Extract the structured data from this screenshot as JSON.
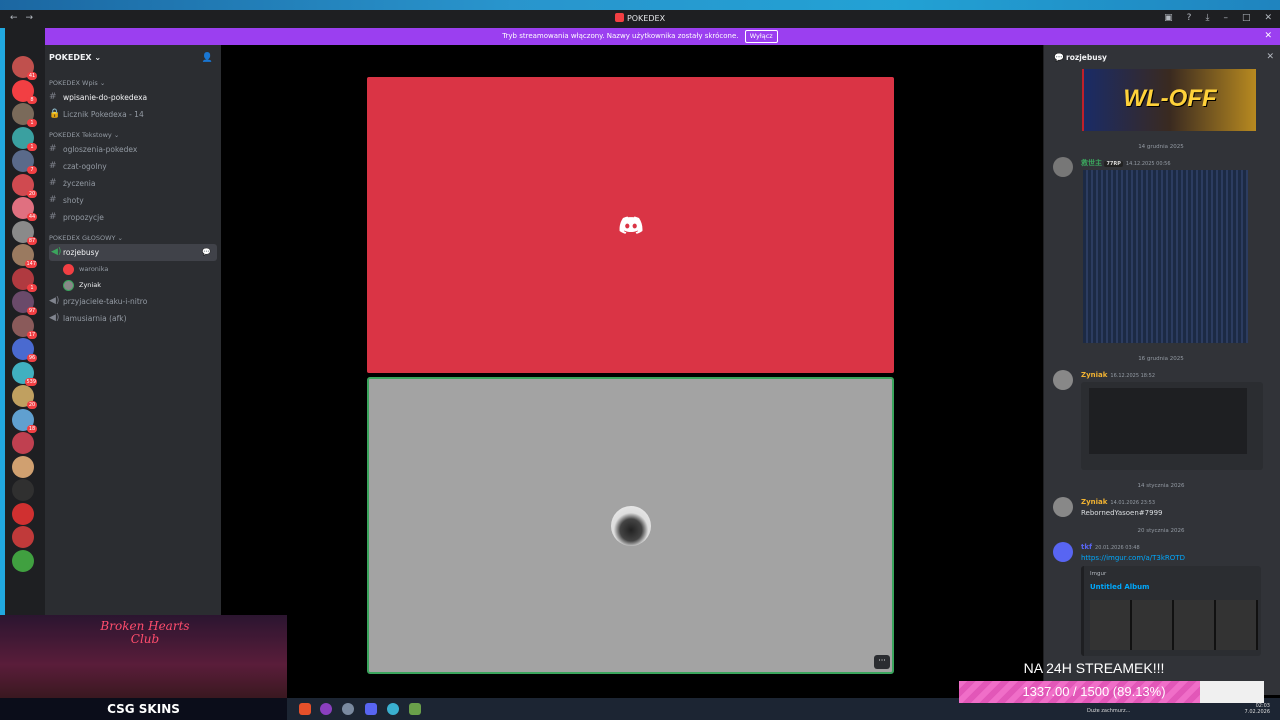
{
  "window": {
    "title": "POKEDEX"
  },
  "banner": {
    "text": "Tryb streamowania włączony. Nazwy użytkownika zostały skrócone.",
    "button": "Wyłącz"
  },
  "server_badges": [
    "41",
    "8",
    "1",
    "1",
    "7",
    "20",
    "44",
    "87",
    "147",
    "1",
    "97",
    "17",
    "96",
    "539",
    "20",
    "18"
  ],
  "sidebar": {
    "guild_name": "POKEDEX",
    "categories": [
      {
        "name": "POKEDEX Wpis",
        "channels": [
          "wpisanie-do-pokedexa",
          "Licznik Pokedexa - 14"
        ]
      },
      {
        "name": "POKEDEX Tekstowy",
        "channels": [
          "ogloszenia-pokedex",
          "czat-ogolny",
          "życzenia",
          "shoty",
          "propozycje"
        ]
      },
      {
        "name": "POKEDEX GŁOSOWY",
        "channels": [
          "rozjebusy",
          "przyjaciele-taku-i-nitro",
          "lamusiarnia (afk)"
        ]
      }
    ],
    "voice_users": [
      "waronika",
      "Zyniak"
    ]
  },
  "chat": {
    "channel": "rozjebusy",
    "image_text": "WL-OFF",
    "dividers": [
      "14 grudnia 2025",
      "16 grudnia 2025",
      "14 stycznia 2026",
      "20 stycznia 2026"
    ],
    "messages": [
      {
        "author": "救世主",
        "tag": "77RP",
        "time": "14.12.2025 00:56",
        "color": "#3ba55d",
        "text": ""
      },
      {
        "author": "Zyniak",
        "time": "16.12.2025 18:52",
        "color": "#f0b232",
        "text": ""
      },
      {
        "author": "Zyniak",
        "time": "14.01.2026 23:53",
        "color": "#f0b232",
        "text": "RebornedYasoen#7999"
      },
      {
        "author": "tkf",
        "time": "20.01.2026 03:48",
        "color": "#5865f2",
        "text": "https://imgur.com/a/T3kROTD"
      }
    ],
    "embed": {
      "provider": "Imgur",
      "title": "Untitled Album"
    }
  },
  "overlay": {
    "cam_title_line1": "Broken Hearts",
    "cam_title_line2": "Club",
    "sponsor": "CSG SKINS",
    "stream_title": "NA 24H STREAMEK!!!",
    "goal_text": "1337.00 / 1500 (89.13%)",
    "goal_fraction": 0.8913
  },
  "tray": {
    "weather": "Duże zachmurz...",
    "time": "02:03",
    "date": "7.02.2026"
  },
  "colors": {
    "accent": "#9b3ff0",
    "tile_red": "#da3445",
    "speaking": "#3ba55d"
  }
}
